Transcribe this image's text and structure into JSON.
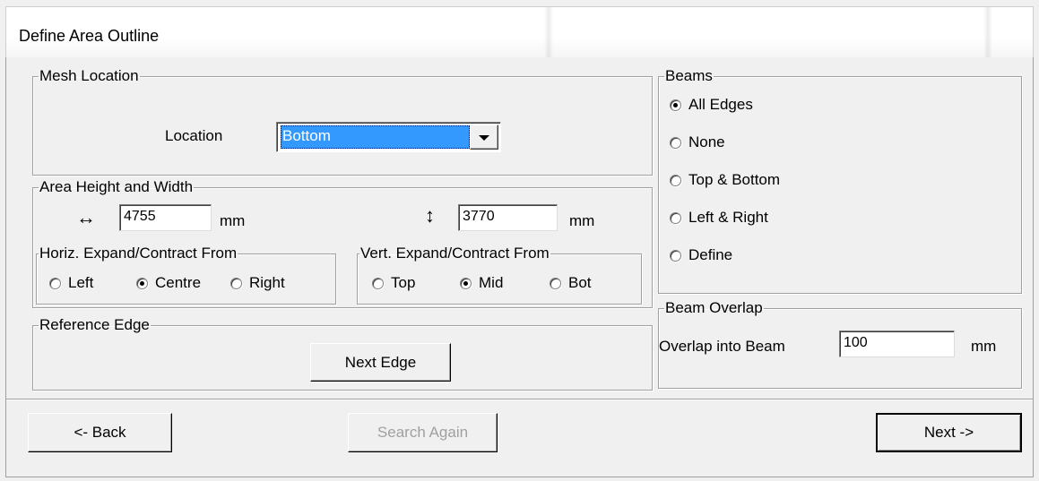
{
  "window": {
    "title": "Define Area Outline"
  },
  "mesh_location": {
    "legend": "Mesh Location",
    "location_label": "Location",
    "location_value": "Bottom"
  },
  "area": {
    "legend": "Area Height and Width",
    "width_value": "4755",
    "width_unit": "mm",
    "height_value": "3770",
    "height_unit": "mm",
    "horiz": {
      "legend": "Horiz. Expand/Contract From",
      "options": [
        "Left",
        "Centre",
        "Right"
      ],
      "selected": "Centre"
    },
    "vert": {
      "legend": "Vert. Expand/Contract From",
      "options": [
        "Top",
        "Mid",
        "Bot"
      ],
      "selected": "Mid"
    }
  },
  "reference_edge": {
    "legend": "Reference Edge",
    "next_edge_label": "Next Edge"
  },
  "beams": {
    "legend": "Beams",
    "options": [
      "All Edges",
      "None",
      "Top & Bottom",
      "Left & Right",
      "Define"
    ],
    "selected": "All Edges"
  },
  "beam_overlap": {
    "legend": "Beam Overlap",
    "label": "Overlap into Beam",
    "value": "100",
    "unit": "mm"
  },
  "footer": {
    "back_label": "<- Back",
    "search_again_label": "Search Again",
    "next_label": "Next ->"
  },
  "icons": {
    "horizontal_arrow": "↔",
    "vertical_arrow": "↕"
  }
}
